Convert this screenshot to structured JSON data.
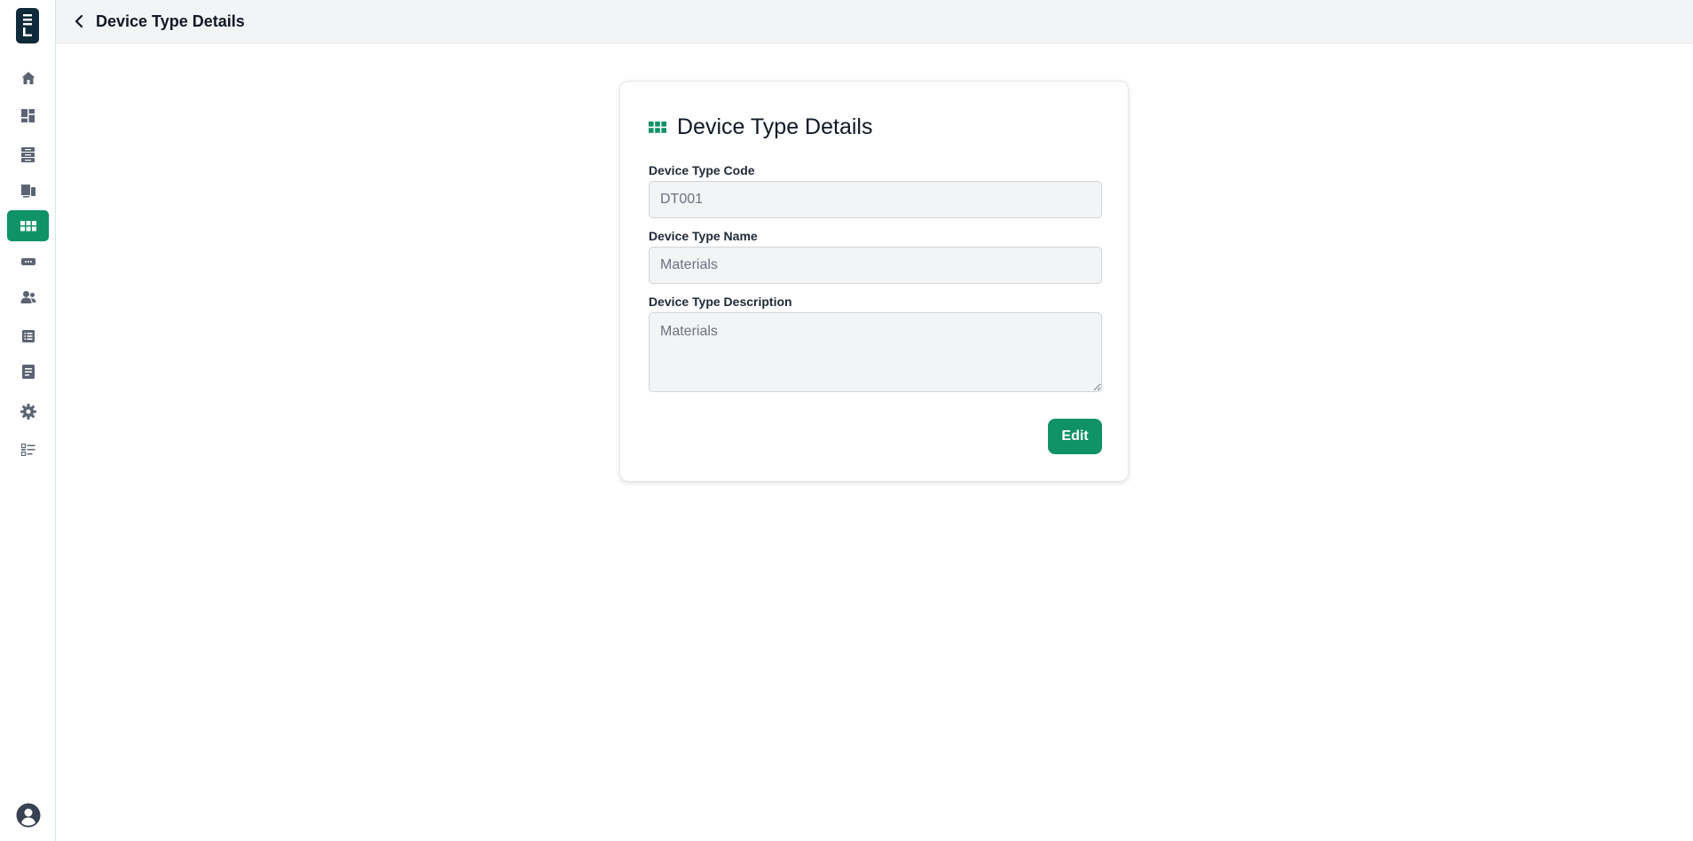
{
  "app": {
    "logo_icon": "app-logo-icon"
  },
  "sidebar": {
    "items": [
      {
        "icon": "home-icon",
        "active": false
      },
      {
        "icon": "dashboard-icon",
        "active": false
      },
      {
        "icon": "storage-icon",
        "active": false
      },
      {
        "icon": "devices-icon",
        "active": false
      },
      {
        "icon": "grid-icon",
        "active": true
      },
      {
        "icon": "card-icon",
        "active": false
      },
      {
        "icon": "users-icon",
        "active": false
      },
      {
        "icon": "list-icon",
        "active": false
      },
      {
        "icon": "document-icon",
        "active": false
      },
      {
        "icon": "settings-icon",
        "active": false
      },
      {
        "icon": "checklist-icon",
        "active": false
      }
    ],
    "profile_icon": "user-circle-icon"
  },
  "header": {
    "title": "Device Type Details",
    "back_icon": "chevron-left-icon"
  },
  "card": {
    "icon": "grid-icon",
    "title": "Device Type Details",
    "fields": {
      "code": {
        "label": "Device Type Code",
        "value": "DT001"
      },
      "name": {
        "label": "Device Type Name",
        "value": "Materials"
      },
      "description": {
        "label": "Device Type Description",
        "value": "Materials"
      }
    },
    "edit_label": "Edit"
  },
  "colors": {
    "accent": "#0f9266",
    "logo_bg": "#0f2a3a",
    "icon_gray": "#5b6472",
    "field_bg": "#f3f4f6",
    "topbar_bg": "#f3f4f6"
  }
}
